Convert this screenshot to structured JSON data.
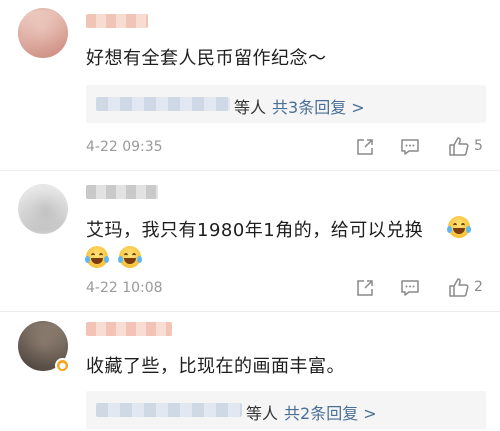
{
  "comments": [
    {
      "text": "好想有全套人民币留作纪念～",
      "reply_people": "等人",
      "reply_count": "共3条回复 >",
      "time": "4-22 09:35",
      "likes": "5"
    },
    {
      "text": "艾玛，我只有1980年1角的，给可以兑换",
      "time": "4-22 10:08",
      "likes": "2"
    },
    {
      "text": "收藏了些，比现在的画面丰富。",
      "reply_people": "等人",
      "reply_count": "共2条回复 >"
    }
  ],
  "colors": {
    "link": "#4a6f96",
    "meta": "#9a9a9a",
    "badge": "#f5a623",
    "reply_bg": "#f5f5f5"
  },
  "icons": {
    "share": "share-icon",
    "comment": "comment-icon",
    "like": "thumbs-up-icon",
    "emoji": "laughing-crying-emoji-icon",
    "verified": "verified-badge-icon"
  }
}
